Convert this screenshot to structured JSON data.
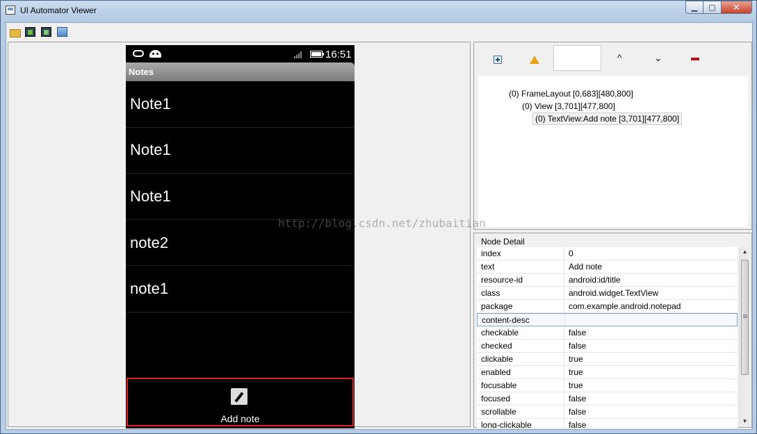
{
  "window": {
    "title": "UI Automator Viewer",
    "close_glyph": "✕",
    "minimize_glyph": "▁",
    "maximize_glyph": "▢"
  },
  "toolbar": {
    "icons": [
      "open-icon",
      "device-screenshot-icon",
      "device-screenshot-compressed-icon",
      "save-icon"
    ]
  },
  "device": {
    "status_time": "16:51",
    "action_bar_title": "Notes",
    "notes": [
      "Note1",
      "Note1",
      "Note1",
      "note2",
      "note1"
    ],
    "add_note_label": "Add note"
  },
  "watermark": "http://blog.csdn.net/zhubaitian",
  "tree_toolbar": {
    "up_glyph": "^",
    "down_glyph": "⌄"
  },
  "tree": [
    {
      "label": "(0) FrameLayout [0,683][480,800]"
    },
    {
      "label": "(0) View [3,701][477,800]"
    },
    {
      "label": "(0) TextView:Add note [3,701][477,800]"
    }
  ],
  "node_detail": {
    "title": "Node Detail",
    "rows": [
      {
        "key": "index",
        "value": "0"
      },
      {
        "key": "text",
        "value": "Add note"
      },
      {
        "key": "resource-id",
        "value": "android:id/title"
      },
      {
        "key": "class",
        "value": "android.widget.TextView"
      },
      {
        "key": "package",
        "value": "com.example.android.notepad"
      },
      {
        "key": "content-desc",
        "value": ""
      },
      {
        "key": "checkable",
        "value": "false"
      },
      {
        "key": "checked",
        "value": "false"
      },
      {
        "key": "clickable",
        "value": "true"
      },
      {
        "key": "enabled",
        "value": "true"
      },
      {
        "key": "focusable",
        "value": "true"
      },
      {
        "key": "focused",
        "value": "false"
      },
      {
        "key": "scrollable",
        "value": "false"
      },
      {
        "key": "long-clickable",
        "value": "false"
      }
    ]
  },
  "colors": {
    "selection_border": "#d22222",
    "title_bar": "#c9dcef"
  }
}
